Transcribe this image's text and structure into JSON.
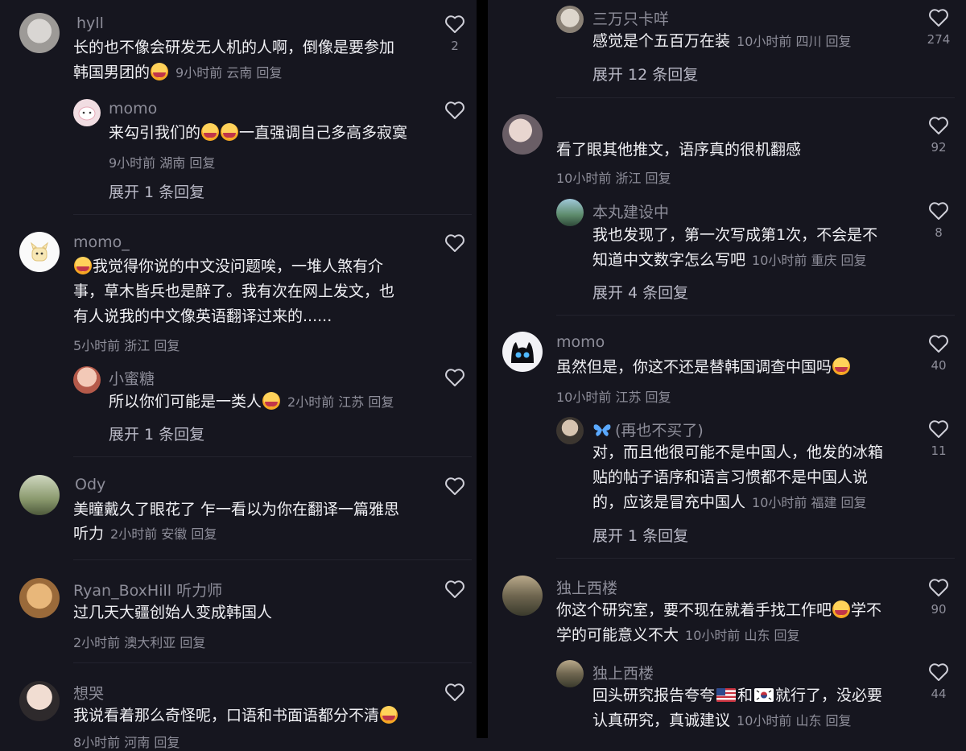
{
  "left": {
    "c1": {
      "user": "hyll",
      "line1": "长的也不像会研发无人机的人啊，倒像是要参加",
      "line2": "韩国男团的",
      "meta": "9小时前 云南 回复",
      "likes": "2",
      "reply": {
        "user": "momo",
        "text_a": "来勾引我们的",
        "text_b": "一直强调自己多高多寂寞",
        "meta": "9小时前 湖南 回复",
        "expand": "展开 1 条回复"
      }
    },
    "c2": {
      "user": "momo_",
      "line1": "我觉得你说的中文没问题唉，一堆人煞有介",
      "line2": "事，草木皆兵也是醉了。我有次在网上发文，也",
      "line3": "有人说我的中文像英语翻译过来的......",
      "meta": "5小时前 浙江 回复",
      "reply": {
        "user": "小蜜糖",
        "text_a": "所以你们可能是一类人",
        "meta": "2小时前 江苏 回复",
        "expand": "展开 1 条回复"
      }
    },
    "c3": {
      "user": "Ody",
      "line1": "美瞳戴久了眼花了 乍一看以为你在翻译一篇雅思",
      "line2": "听力",
      "meta": "2小时前 安徽 回复"
    },
    "c4": {
      "user": "Ryan_BoxHill 听力师",
      "line1": "过几天大疆创始人变成韩国人",
      "meta": "2小时前 澳大利亚 回复"
    },
    "c5": {
      "user": "想哭",
      "line1": "我说看着那么奇怪呢，口语和书面语都分不清",
      "meta": "8小时前 河南 回复"
    }
  },
  "right": {
    "r1": {
      "user": "三万只卡咩",
      "text": "感觉是个五百万在装",
      "meta": "10小时前 四川 回复",
      "likes": "274",
      "expand": "展开 12 条回复"
    },
    "r2": {
      "text": "看了眼其他推文，语序真的很机翻感",
      "meta": "10小时前 浙江 回复",
      "likes": "92",
      "reply": {
        "user": "本丸建设中",
        "line1": "我也发现了，第一次写成第1次，不会是不",
        "line2": "知道中文数字怎么写吧",
        "meta": "10小时前 重庆 回复",
        "likes": "8",
        "expand": "展开 4 条回复"
      }
    },
    "r3": {
      "user": "momo",
      "text": "虽然但是，你这不还是替韩国调查中国吗",
      "meta": "10小时前 江苏 回复",
      "likes": "40",
      "reply": {
        "user": "(再也不买了)",
        "line1": "对，而且他很可能不是中国人，他发的冰箱",
        "line2": "贴的帖子语序和语言习惯都不是中国人说",
        "line3": "的，应该是冒充中国人",
        "meta": "10小时前 福建 回复",
        "likes": "11",
        "expand": "展开 1 条回复"
      }
    },
    "r4": {
      "user": "独上西楼",
      "line1": "你这个研究室，要不现在就着手找工作吧",
      "line1b": "学不",
      "line2": "学的可能意义不大",
      "meta": "10小时前 山东 回复",
      "likes": "90",
      "reply": {
        "user": "独上西楼",
        "line1a": "回头研究报告夸夸",
        "line1b": "和",
        "line1c": "就行了，没必要",
        "line2": "认真研究，真诚建议",
        "meta": "10小时前 山东 回复",
        "likes": "44"
      }
    }
  },
  "colors": {
    "background": "#16161f",
    "muted": "#8d8d99",
    "text": "#f0f0f4",
    "accent_butterfly": "#5aa9ff"
  },
  "icons": [
    "heart-outline-icon",
    "crying-emoji-icon",
    "us-flag-icon",
    "korea-flag-icon",
    "butterfly-icon"
  ]
}
